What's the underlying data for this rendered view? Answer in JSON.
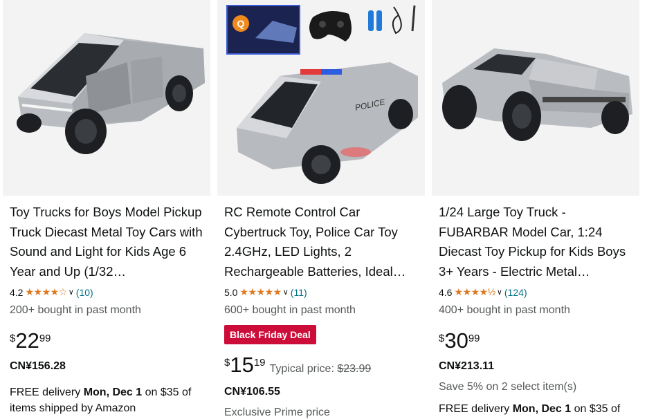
{
  "products": [
    {
      "title": "Toy Trucks for Boys Model Pickup Truck Diecast Metal Toy Cars with Sound and Light for Kids Age 6 Year and Up (1/32…",
      "rating": "4.2",
      "stars": "★★★★☆",
      "review_count": "(10)",
      "bought": "200+ bought in past month",
      "price_symbol": "$",
      "price_whole": "22",
      "price_fraction": "99",
      "cny_price": "CN¥156.28",
      "delivery_prefix": "FREE delivery ",
      "delivery_date": "Mon, Dec 1",
      "delivery_suffix": " on $35 of items shipped by Amazon"
    },
    {
      "title": "RC Remote Control Car Cybertruck Toy, Police Car Toy 2.4GHz, LED Lights, 2 Rechargeable Batteries, Ideal…",
      "rating": "5.0",
      "stars": "★★★★★",
      "review_count": "(11)",
      "bought": "600+ bought in past month",
      "deal_badge": "Black Friday Deal",
      "price_symbol": "$",
      "price_whole": "15",
      "price_fraction": "19",
      "typical_label": "Typical price: ",
      "typical_price": "$23.99",
      "cny_price": "CN¥106.55",
      "exclusive": "Exclusive Prime price"
    },
    {
      "title": "1/24 Large Toy Truck - FUBARBAR Model Car, 1:24 Diecast Toy Pickup for Kids Boys 3+ Years - Electric Metal…",
      "rating": "4.6",
      "stars": "★★★★½",
      "review_count": "(124)",
      "bought": "400+ bought in past month",
      "price_symbol": "$",
      "price_whole": "30",
      "price_fraction": "99",
      "cny_price": "CN¥213.11",
      "save_text": "Save 5% on 2 select item(s)",
      "delivery_prefix": "FREE delivery ",
      "delivery_date": "Mon, Dec 1",
      "delivery_suffix": " on $35 of"
    }
  ],
  "image2_overlay": {
    "box_letter": "Q",
    "police_text": "POLICE"
  },
  "colors": {
    "star": "#de7921",
    "link": "#007185",
    "deal": "#cc0c39",
    "muted": "#565959"
  },
  "icons": [
    "chevron-down-icon",
    "star-icon"
  ]
}
